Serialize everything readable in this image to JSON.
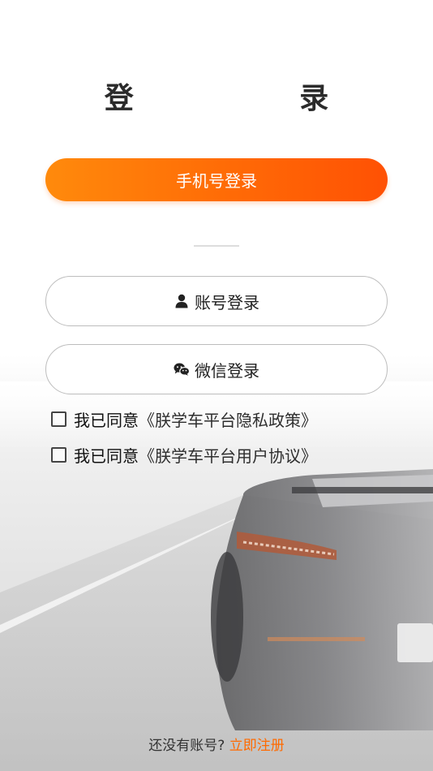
{
  "title": "登 录",
  "buttons": {
    "phone_login": "手机号登录",
    "account_login": "账号登录",
    "wechat_login": "微信登录"
  },
  "agreements": [
    {
      "checked": false,
      "prefix": "我已同意",
      "link": "《朕学车平台隐私政策》"
    },
    {
      "checked": false,
      "prefix": "我已同意",
      "link": "《朕学车平台用户协议》"
    }
  ],
  "footer": {
    "prompt": "还没有账号?",
    "register_link": "立即注册"
  },
  "colors": {
    "accent": "#ff6a06",
    "accent_start": "#ff8a0c",
    "accent_end": "#ff5104"
  },
  "icons": {
    "account": "person-icon",
    "wechat": "wechat-icon"
  }
}
